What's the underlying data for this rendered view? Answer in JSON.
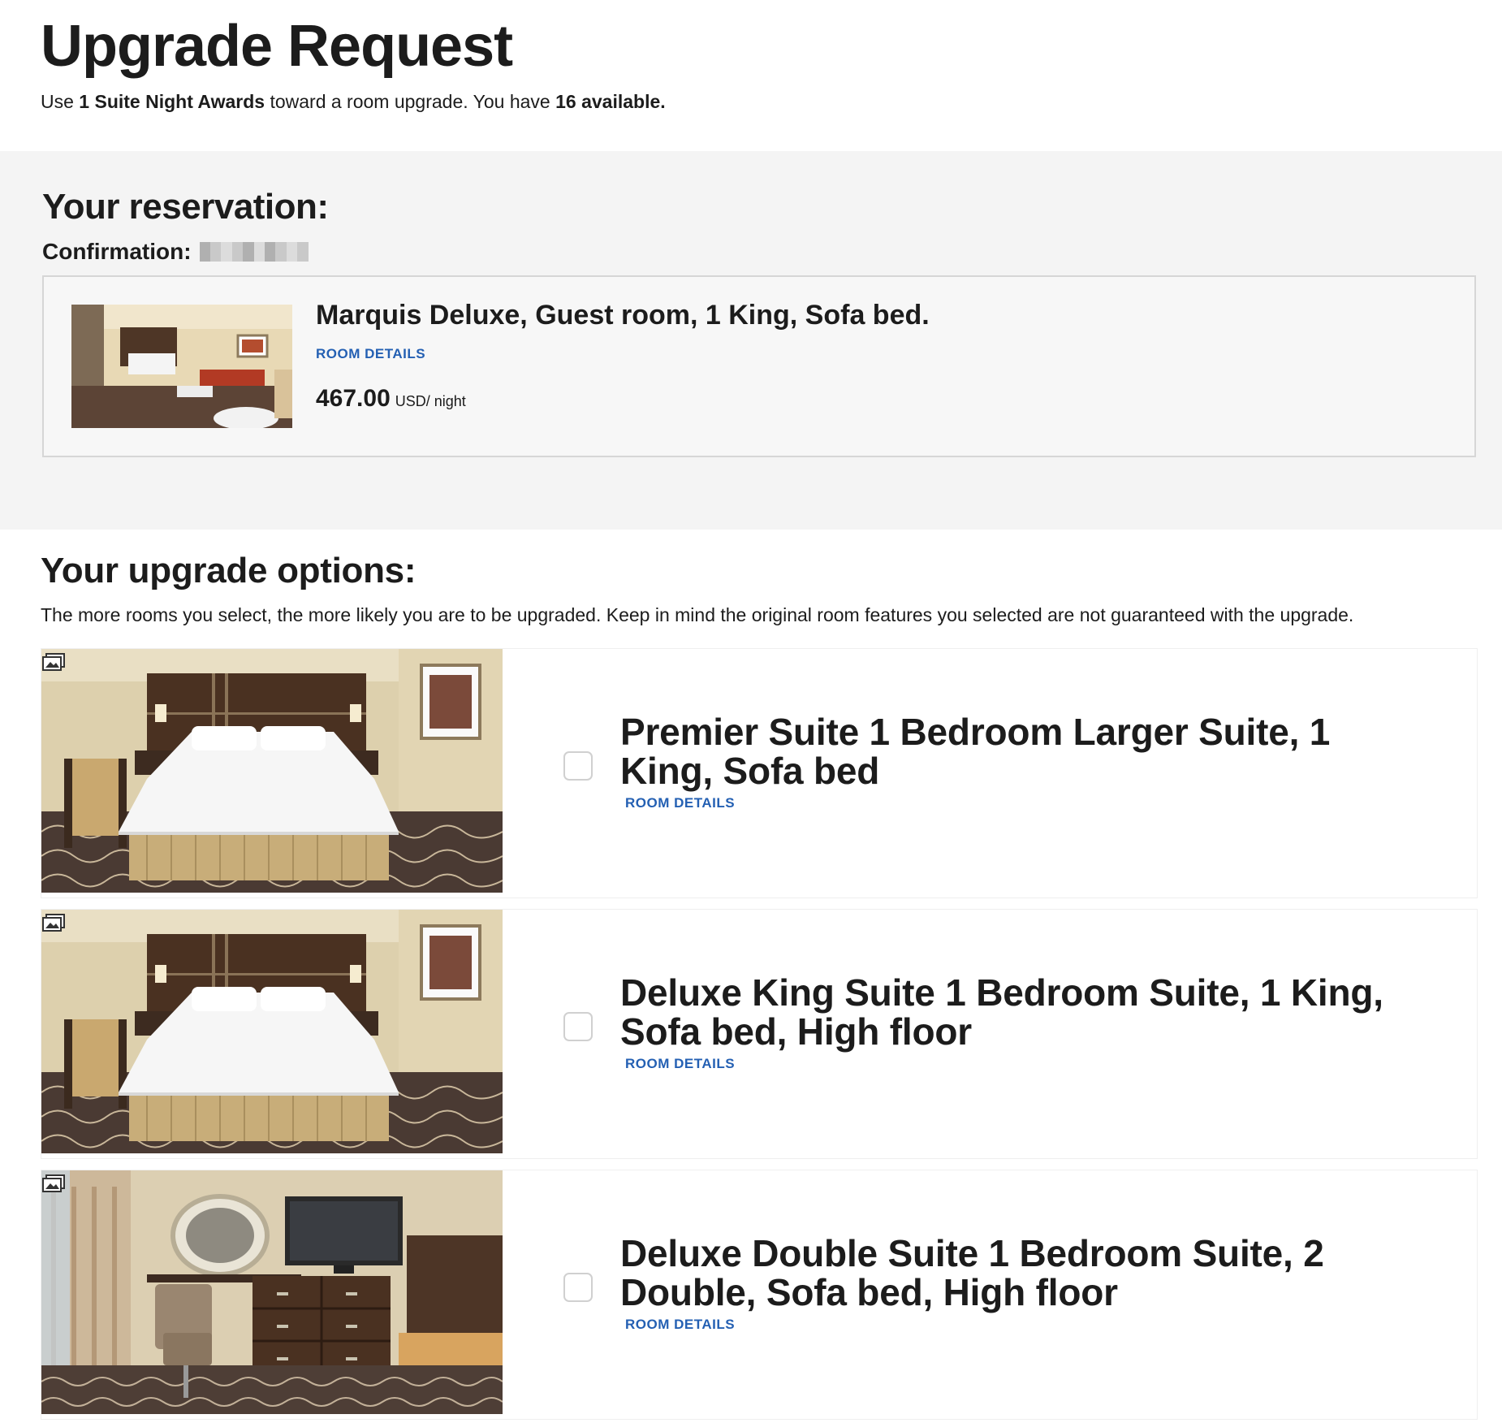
{
  "header": {
    "title": "Upgrade Request",
    "intro_prefix": "Use ",
    "intro_awards": "1 Suite Night Awards",
    "intro_middle": " toward a room upgrade. You have ",
    "intro_available": "16 available."
  },
  "reservation": {
    "heading": "Your reservation:",
    "confirmation_label": "Confirmation:",
    "room_name": "Marquis Deluxe, Guest room, 1 King, Sofa bed.",
    "room_details_link": "ROOM DETAILS",
    "price": "467.00",
    "price_unit": "USD/ night"
  },
  "options": {
    "heading": "Your upgrade options:",
    "note": "The more rooms you select, the more likely you are to be upgraded. Keep in mind the original room features you selected are not guaranteed with the upgrade.",
    "items": [
      {
        "title": "Premier Suite 1 Bedroom Larger Suite, 1 King, Sofa bed",
        "link": "ROOM DETAILS",
        "image": "bedroom-photo",
        "checked": false
      },
      {
        "title": "Deluxe King Suite 1 Bedroom Suite, 1 King, Sofa bed, High floor",
        "link": "ROOM DETAILS",
        "image": "bedroom-photo",
        "checked": false
      },
      {
        "title": "Deluxe Double Suite 1 Bedroom Suite, 2 Double, Sofa bed, High floor",
        "link": "ROOM DETAILS",
        "image": "living-room-photo",
        "checked": false
      }
    ]
  },
  "colors": {
    "link": "#2460b3",
    "panel_bg": "#f4f4f4",
    "text": "#1c1c1c"
  }
}
